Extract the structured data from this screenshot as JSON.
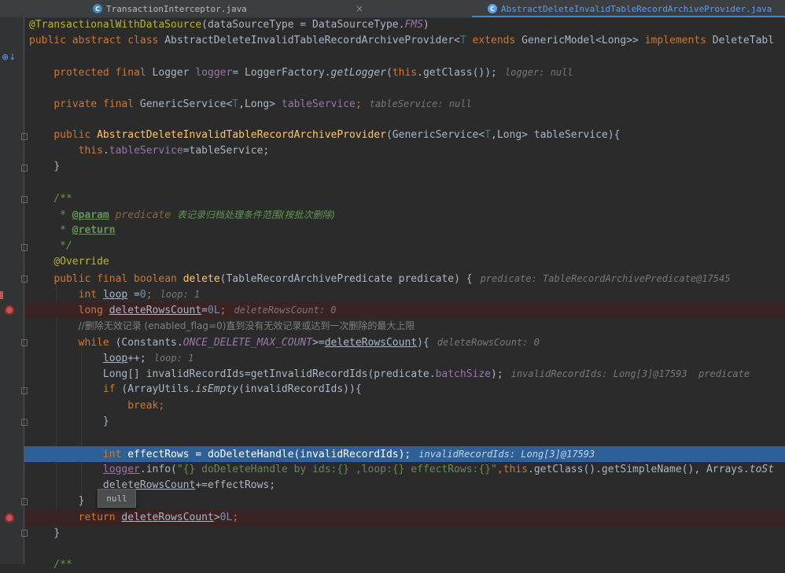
{
  "tabs": [
    {
      "label": "TransactionInterceptor.java",
      "active": false
    },
    {
      "label": "AbstractDeleteInvalidTableRecordArchiveProvider.java",
      "active": true
    }
  ],
  "code": {
    "l1": {
      "a": "@TransactionalWithDataSource",
      "b": "(dataSourceType = DataSourceType.",
      "c": "FMS",
      "d": ")"
    },
    "l2": {
      "a": "public abstract class ",
      "b": "AbstractDeleteInvalidTableRecordArchiveProvider",
      "c": "<",
      "d": "T",
      "e": " extends ",
      "f": "GenericModel<Long>> ",
      "g": "implements ",
      "h": "DeleteTabl"
    },
    "l4": {
      "a": "protected final ",
      "b": "Logger ",
      "c": "logger",
      "d": "= LoggerFactory.",
      "e": "getLogger",
      "f": "(",
      "g": "this",
      "h": ".getClass());",
      "hint": "logger: null"
    },
    "l6": {
      "a": "private final ",
      "b": "GenericService<",
      "c": "T",
      "d": ",Long> ",
      "e": "tableService",
      "f": ";",
      "hint": "tableService: null"
    },
    "l8": {
      "a": "public ",
      "b": "AbstractDeleteInvalidTableRecordArchiveProvider",
      "c": "(GenericService<",
      "d": "T",
      "e": ",Long> tableService){"
    },
    "l9": {
      "a": "this",
      "b": ".",
      "c": "tableService",
      "d": "=tableService;"
    },
    "l10": {
      "a": "}"
    },
    "l12": {
      "a": "/**"
    },
    "l13": {
      "a": " * ",
      "b": "@param",
      "c": " predicate ",
      "d": "表记录归档处理条件范围(按批次删除)"
    },
    "l14": {
      "a": " * ",
      "b": "@return"
    },
    "l15": {
      "a": " */"
    },
    "l16": {
      "a": "@Override"
    },
    "l17": {
      "a": "public final boolean ",
      "b": "delete",
      "c": "(TableRecordArchivePredicate predicate) {",
      "hint": "predicate: TableRecordArchivePredicate@17545"
    },
    "l18": {
      "a": "int ",
      "b": "loop",
      "c": " =",
      "d": "0",
      "e": ";",
      "hint": "loop: 1"
    },
    "l19": {
      "a": "long ",
      "b": "deleteRowsCount",
      "c": "=",
      "d": "0L",
      "e": ";",
      "hint": "deleteRowsCount: 0"
    },
    "l20": {
      "a": "//删除无效记录 (enabled_flag=0)直到没有无效记录或达到一次删除的最大上限"
    },
    "l21": {
      "a": "while ",
      "b": "(Constants.",
      "c": "ONCE_DELETE_MAX_COUNT",
      "d": ">=",
      "e": "deleteRowsCount",
      "f": "){",
      "hint": "deleteRowsCount: 0"
    },
    "l22": {
      "a": "loop",
      "b": "++;",
      "hint": "loop: 1"
    },
    "l23": {
      "a": "Long[] invalidRecordIds=getInvalidRecordIds(predicate.",
      "b": "batchSize",
      "c": ");",
      "hint": "invalidRecordIds: Long[3]@17593  predicate"
    },
    "l24": {
      "a": "if ",
      "b": "(ArrayUtils.",
      "c": "isEmpty",
      "d": "(invalidRecordIds)){"
    },
    "l25": {
      "a": "break",
      "b": ";"
    },
    "l26": {
      "a": "}"
    },
    "l28": {
      "a": "int ",
      "b": "effectRows = doDeleteHandle(invalidRecordIds);",
      "hint": "invalidRecordIds: Long[3]@17593"
    },
    "l29": {
      "a": "logger",
      "b": ".info(",
      "c": "\"{} doDeleteHandle by ids:{} ,loop:{} effectRows:{}\"",
      "d": ",",
      "e": "this",
      "f": ".getClass().getSimpleName(), Arrays.",
      "g": "toSt"
    },
    "l30": {
      "a": "deleteRowsCount",
      "b": "+=effectRows;"
    },
    "l31": {
      "a": "}"
    },
    "l32": {
      "a": "return ",
      "b": "deleteRowsCount",
      "c": ">",
      "d": "0L",
      "e": ";"
    },
    "l33": {
      "a": "}"
    },
    "l35": {
      "a": "/**"
    }
  },
  "tooltip": {
    "text": "null"
  },
  "colors": {
    "breakpoint": "#c75450",
    "execution_line": "#2d6099",
    "background": "#2b2b2b"
  }
}
